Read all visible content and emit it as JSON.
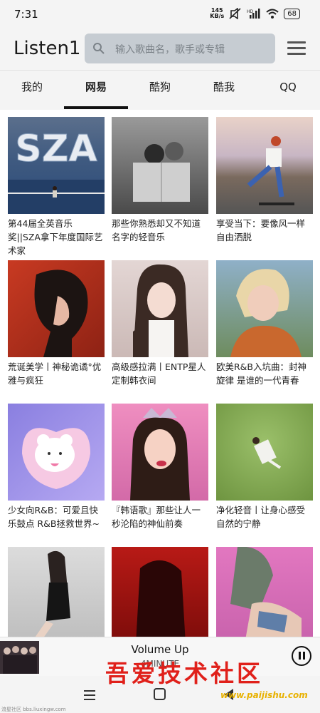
{
  "status_bar": {
    "time": "7:31",
    "net_speed_value": "145",
    "net_speed_unit": "KB/s",
    "battery": "68"
  },
  "header": {
    "title": "Listen1",
    "search_placeholder": "输入歌曲名，歌手或专辑",
    "menu_icon": "hamburger-menu-icon"
  },
  "tabs": [
    {
      "label": "我的",
      "active": false
    },
    {
      "label": "网易",
      "active": true
    },
    {
      "label": "酷狗",
      "active": false
    },
    {
      "label": "酷我",
      "active": false
    },
    {
      "label": "QQ",
      "active": false
    }
  ],
  "playlists": [
    {
      "title": "第44届全英音乐奖||SZA拿下年度国际艺术家",
      "cover_text": "SZA"
    },
    {
      "title": "那些你熟悉却又不知道名字的轻音乐"
    },
    {
      "title": "享受当下：要像风一样自由洒脱"
    },
    {
      "title": "荒诞美学丨神秘诡谲°优雅与疯狂"
    },
    {
      "title": "高级感拉满丨ENTP星人定制韩衣间"
    },
    {
      "title": "欧美R&B入坑曲：封神旋律 是谁的一代青春"
    },
    {
      "title": "少女向R&B：可爱且快乐鼓点 R&B拯救世界~"
    },
    {
      "title": "『韩语歌』那些让人一秒沦陷的神仙前奏"
    },
    {
      "title": "净化轻音丨让身心感受自然的宁静"
    },
    {
      "title": ""
    },
    {
      "title": ""
    },
    {
      "title": ""
    }
  ],
  "player": {
    "title": "Volume Up",
    "artist": "4MINUTE",
    "state": "playing"
  },
  "watermark": {
    "text": "吾爱技术社区",
    "url": "www.paijishu.com",
    "small": "流星社区 bbs.liuxingw.com"
  },
  "colors": {
    "accent": "#111111",
    "search_bg": "#c6ccd2",
    "watermark": "#e0201a"
  }
}
